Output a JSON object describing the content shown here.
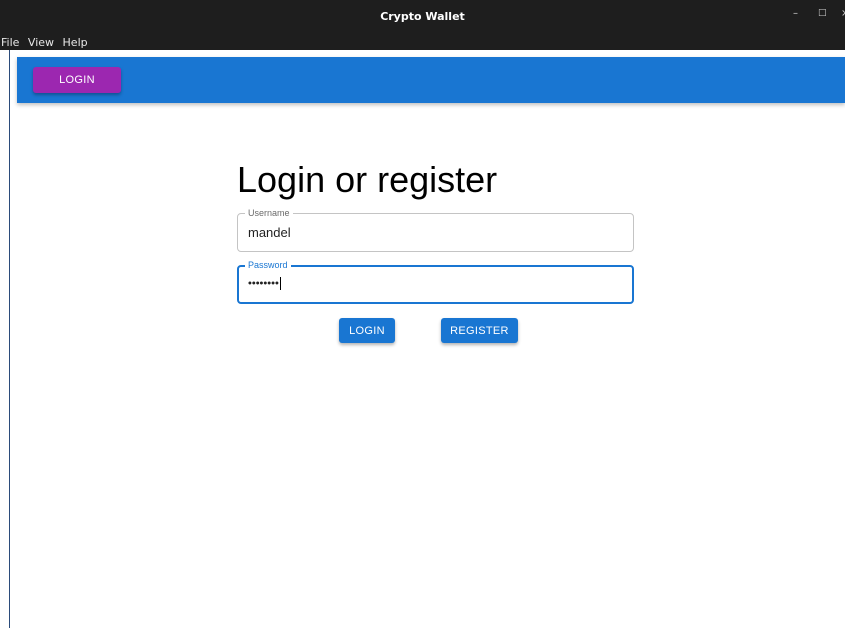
{
  "window": {
    "title": "Crypto Wallet",
    "controls": {
      "minimize": "–",
      "maximize": "□",
      "close": "×"
    }
  },
  "menu": {
    "items": [
      "File",
      "View",
      "Help"
    ]
  },
  "appbar": {
    "login_label": "LOGIN",
    "color": "#1976d2",
    "button_color": "#9c27b0"
  },
  "form": {
    "heading": "Login or register",
    "username": {
      "label": "Username",
      "value": "mandel"
    },
    "password": {
      "label": "Password",
      "value": "••••••••"
    },
    "login_label": "LOGIN",
    "register_label": "REGISTER"
  },
  "colors": {
    "accent": "#1976d2",
    "secondary": "#9c27b0",
    "titlebar": "#1e1e1e"
  }
}
